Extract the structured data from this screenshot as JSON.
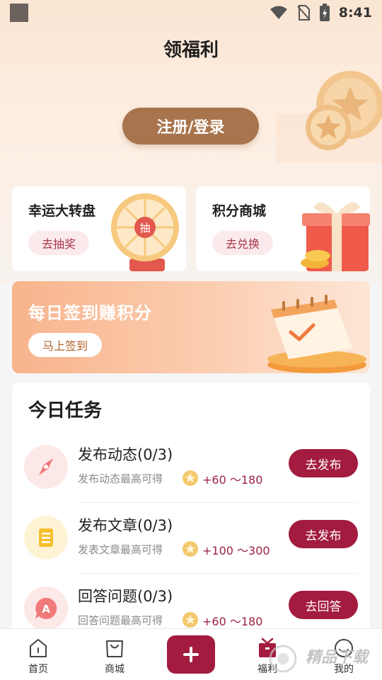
{
  "status_bar": {
    "time": "8:41",
    "icons": [
      "wifi-icon",
      "no-sim-icon",
      "battery-charging-icon"
    ]
  },
  "header": {
    "title": "领福利",
    "login_label": "注册/登录"
  },
  "features": [
    {
      "title": "幸运大转盘",
      "button": "去抽奖",
      "wheel_center": "抽",
      "icon": "prize-wheel-icon"
    },
    {
      "title": "积分商城",
      "button": "去兑换",
      "icon": "gift-box-icon"
    }
  ],
  "signin": {
    "title": "每日签到赚积分",
    "button": "马上签到",
    "icon": "calendar-check-icon"
  },
  "tasks": {
    "title": "今日任务",
    "items": [
      {
        "name": "发布动态(0/3)",
        "desc": "发布动态最高可得",
        "reward": "+60 ～180",
        "button": "去发布",
        "icon": "compass-icon",
        "icon_bg": "#fde8e8",
        "icon_color": "#f07a7a"
      },
      {
        "name": "发布文章(0/3)",
        "desc": "发表文章最高可得",
        "reward": "+100 ～300",
        "button": "去发布",
        "icon": "article-icon",
        "icon_bg": "#fff3d6",
        "icon_color": "#f6bf2e"
      },
      {
        "name": "回答问题(0/3)",
        "desc": "回答问题最高可得",
        "reward": "+60 ～180",
        "button": "去回答",
        "icon": "answer-icon",
        "icon_bg": "#fde8e8",
        "icon_color": "#f07a7a"
      }
    ]
  },
  "tabbar": {
    "items": [
      {
        "label": "首页",
        "icon": "home-icon"
      },
      {
        "label": "商城",
        "icon": "shopping-bag-icon"
      },
      {
        "label": "",
        "icon": "plus-icon"
      },
      {
        "label": "福利",
        "icon": "gift-icon"
      },
      {
        "label": "我的",
        "icon": "profile-icon"
      }
    ]
  },
  "watermark": "精品下载",
  "colors": {
    "primary": "#a31b3f",
    "login_button": "#a8744d"
  }
}
